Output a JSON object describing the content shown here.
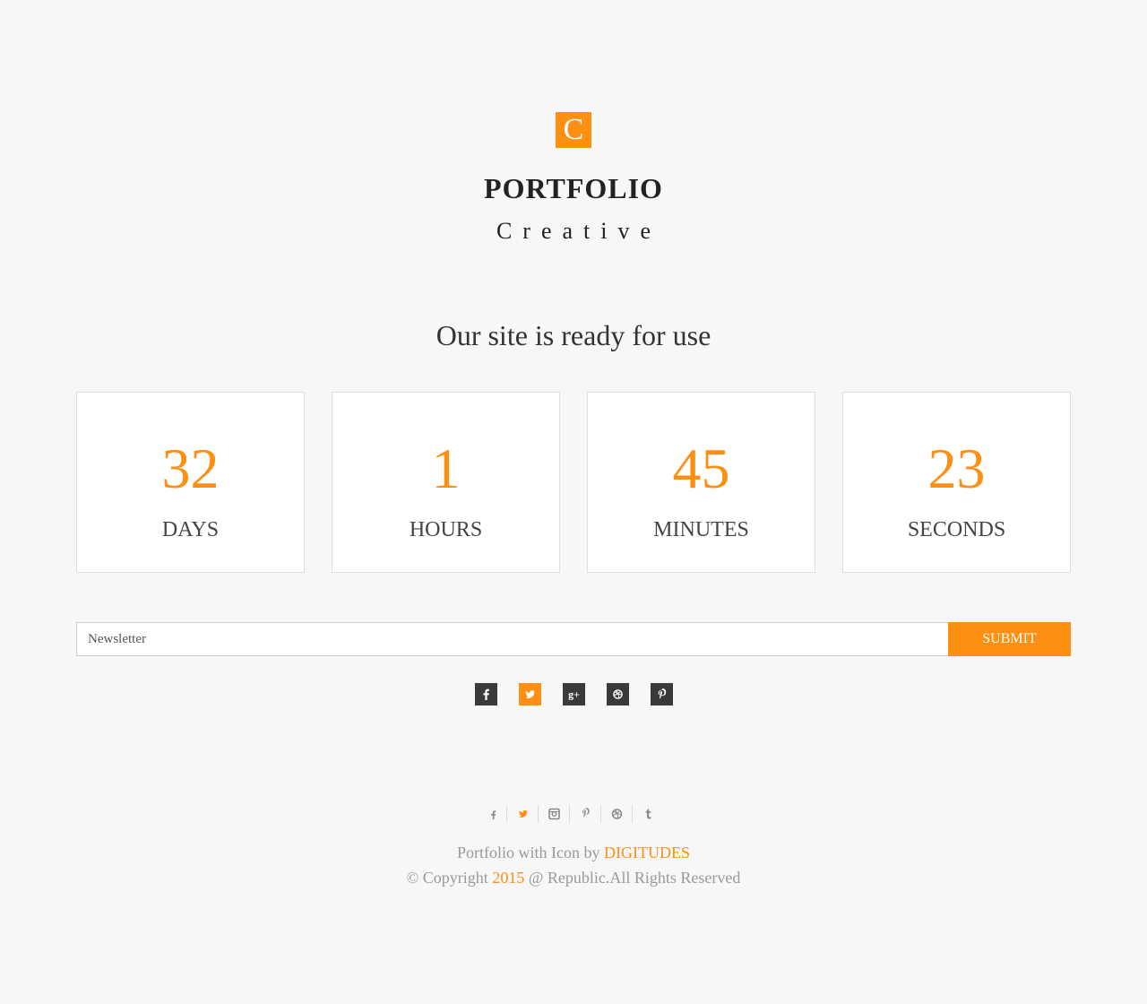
{
  "brand": {
    "logo_letter": "C",
    "title": "PORTFOLIO",
    "subtitle": "Creative"
  },
  "headline": "Our site is ready for use",
  "countdown": [
    {
      "value": "32",
      "label": "DAYS"
    },
    {
      "value": "1",
      "label": "HOURS"
    },
    {
      "value": "45",
      "label": "MINUTES"
    },
    {
      "value": "23",
      "label": "SECONDS"
    }
  ],
  "newsletter": {
    "placeholder": "Newsletter",
    "submit_label": "SUBMIT"
  },
  "social": [
    {
      "icon": "facebook-icon",
      "glyph": "f",
      "active": false
    },
    {
      "icon": "twitter-icon",
      "glyph": "t",
      "active": true
    },
    {
      "icon": "google-plus-icon",
      "glyph": "g+",
      "active": false
    },
    {
      "icon": "dribbble-icon",
      "glyph": "d",
      "active": false
    },
    {
      "icon": "pinterest-icon",
      "glyph": "p",
      "active": false
    }
  ],
  "footer_icons": [
    {
      "icon": "facebook-icon",
      "glyph": "f",
      "active": false
    },
    {
      "icon": "twitter-icon",
      "glyph": "t",
      "active": true
    },
    {
      "icon": "instagram-icon",
      "glyph": "ig",
      "active": false
    },
    {
      "icon": "pinterest-icon",
      "glyph": "p",
      "active": false
    },
    {
      "icon": "dribbble-icon",
      "glyph": "d",
      "active": false
    },
    {
      "icon": "tumblr-icon",
      "glyph": "t",
      "active": false
    }
  ],
  "footer": {
    "credit_prefix": "Portfolio with Icon by ",
    "credit_link": "DIGITUDES",
    "copyright_prefix": "© Copyright ",
    "copyright_year": "2015",
    "copyright_suffix": " @ Republic.All Rights Reserved"
  },
  "colors": {
    "accent": "#fd8f12",
    "background": "#f7f7f7",
    "dark_icon_bg": "#3a3a3a"
  }
}
